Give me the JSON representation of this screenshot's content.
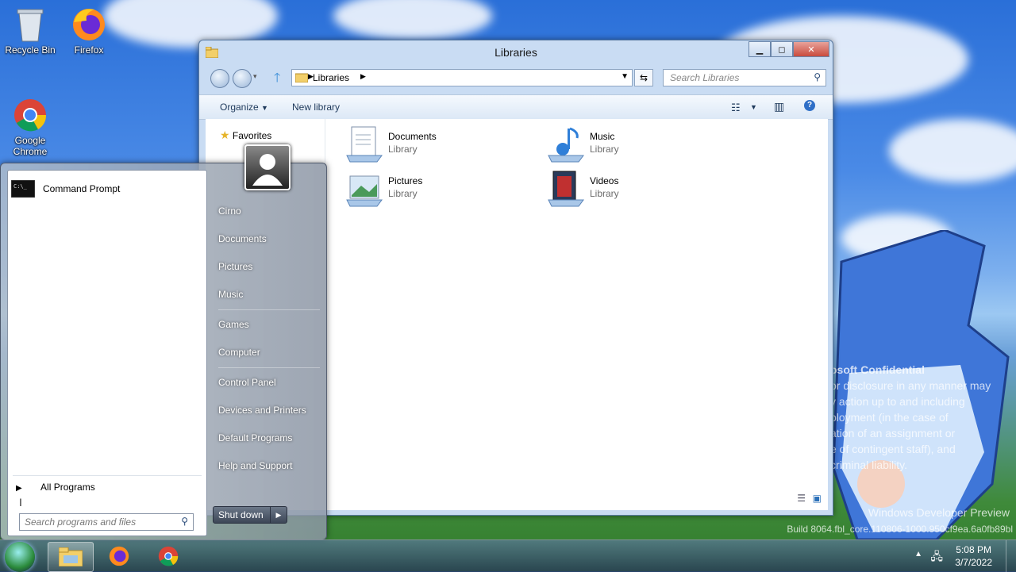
{
  "desktop": {
    "icons": [
      {
        "label": "Recycle Bin"
      },
      {
        "label": "Firefox"
      },
      {
        "label": "Google Chrome"
      }
    ],
    "watermark": {
      "confidential_title": "osoft Confidential",
      "confidential_lines": [
        "or disclosure in any manner may",
        "y action up to and including",
        "ployment (in the case of",
        "ation of an assignment or",
        "e of contingent staff), and",
        "criminal liability."
      ],
      "build_line1": "Windows Developer Preview",
      "build_line2": "Build 8064.fbl_core.110806-1000.950cf9ea.6a0fb89bl"
    }
  },
  "explorer": {
    "title": "Libraries",
    "address": "Libraries",
    "search_placeholder": "Search Libraries",
    "toolbar": {
      "organize": "Organize",
      "new_library": "New library"
    },
    "nav": {
      "favorites": "Favorites"
    },
    "libraries": [
      {
        "name": "Documents",
        "type": "Library"
      },
      {
        "name": "Music",
        "type": "Library"
      },
      {
        "name": "Pictures",
        "type": "Library"
      },
      {
        "name": "Videos",
        "type": "Library"
      }
    ]
  },
  "start_menu": {
    "pinned": [
      {
        "label": "Command Prompt"
      }
    ],
    "all_programs": "All Programs",
    "search_placeholder": "Search programs and files",
    "user": "Cirno",
    "right_items": [
      "Documents",
      "Pictures",
      "Music",
      "Games",
      "Computer",
      "Control Panel",
      "Devices and Printers",
      "Default Programs",
      "Help and Support"
    ],
    "shutdown": "Shut down"
  },
  "taskbar": {
    "time": "5:08 PM",
    "date": "3/7/2022"
  }
}
